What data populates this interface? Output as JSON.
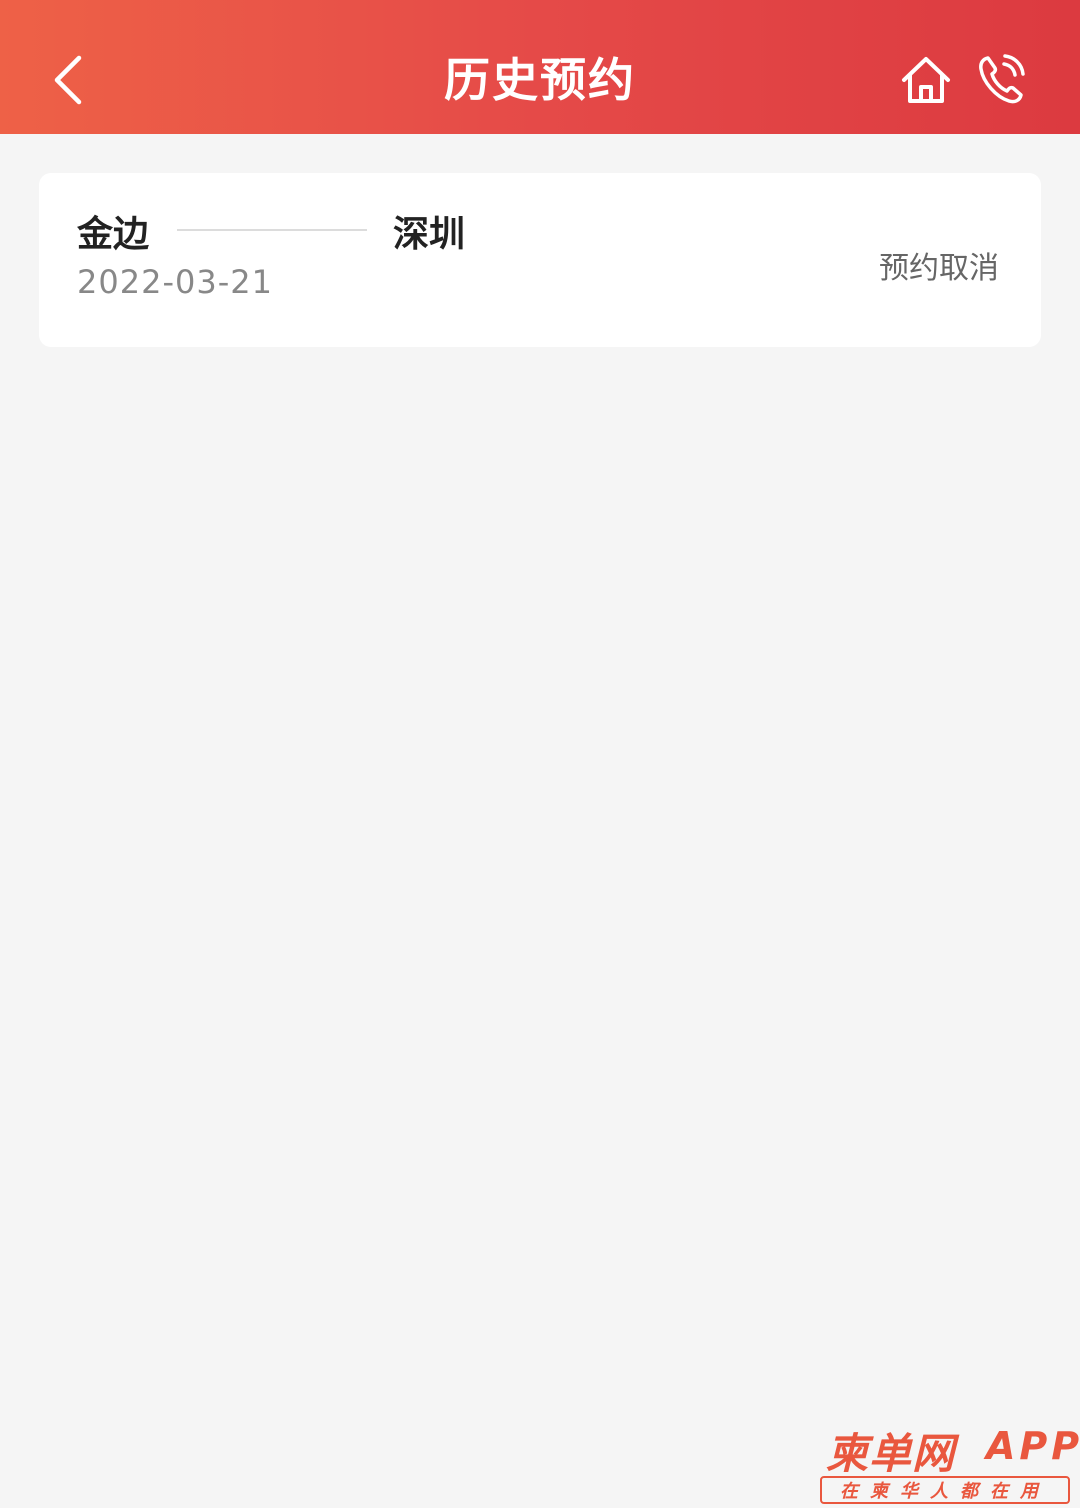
{
  "header": {
    "title": "历史预约",
    "background": "#e54a48",
    "icons": {
      "back": "chevron-left-icon",
      "home": "home-icon",
      "phone": "phone-icon"
    }
  },
  "appointments": [
    {
      "from": "金边",
      "to": "深圳",
      "date": "2022-03-21",
      "status": "预约取消"
    }
  ],
  "watermark": {
    "brand": "柬单网",
    "app": "APP",
    "slogan": "在柬华人都在用",
    "color": "#e9573e"
  }
}
